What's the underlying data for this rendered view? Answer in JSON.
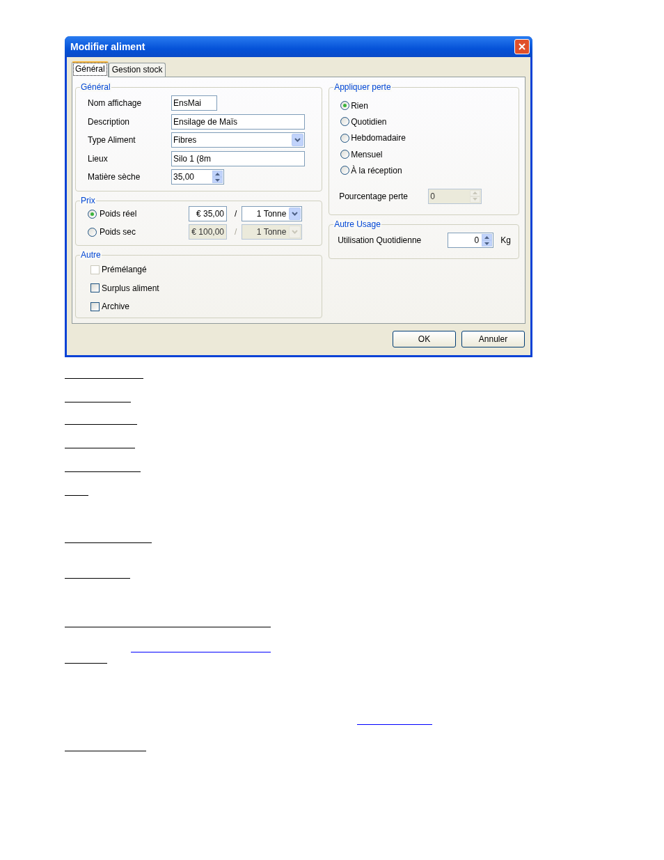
{
  "window": {
    "title": "Modifier aliment"
  },
  "tabs": [
    {
      "label": "Général",
      "selected": true
    },
    {
      "label": "Gestion stock",
      "selected": false
    }
  ],
  "general": {
    "title": "Général",
    "fields": [
      {
        "label": "Nom affichage",
        "kind": "text",
        "value": "EnsMai"
      },
      {
        "label": "Description",
        "kind": "text",
        "value": "Ensilage de Maïs"
      },
      {
        "label": "Type Aliment",
        "kind": "select",
        "value": "Fibres"
      },
      {
        "label": "Lieux",
        "kind": "text",
        "value": "Silo 1 (8m"
      },
      {
        "label": "Matière sèche",
        "kind": "spin",
        "value": "35,00"
      }
    ]
  },
  "prix": {
    "title": "Prix",
    "options": [
      {
        "label": "Poids réel",
        "selected": true,
        "amount": "€ 35,00",
        "separator": "/",
        "unit": "1 Tonne"
      },
      {
        "label": "Poids sec",
        "selected": false,
        "amount": "€ 100,00",
        "separator": "/",
        "unit": "1 Tonne"
      }
    ]
  },
  "autre": {
    "title": "Autre",
    "checkboxes": [
      {
        "label": "Prémélangé",
        "checked": false,
        "disabled": true
      },
      {
        "label": "Surplus aliment",
        "checked": false,
        "disabled": false
      },
      {
        "label": "Archive",
        "checked": false,
        "disabled": false
      }
    ]
  },
  "appliquer_perte": {
    "title": "Appliquer perte",
    "options": [
      {
        "label": "Rien",
        "selected": true
      },
      {
        "label": "Quotidien",
        "selected": false
      },
      {
        "label": "Hebdomadaire",
        "selected": false
      },
      {
        "label": "Mensuel",
        "selected": false
      },
      {
        "label": "À la réception",
        "selected": false
      }
    ],
    "percentage": {
      "label": "Pourcentage perte",
      "value": "0",
      "disabled": true
    }
  },
  "autre_usage": {
    "title": "Autre Usage",
    "label": "Utilisation Quotidienne",
    "value": "0",
    "unit": "Kg"
  },
  "buttons": [
    {
      "label": "OK"
    },
    {
      "label": "Annuler"
    }
  ]
}
